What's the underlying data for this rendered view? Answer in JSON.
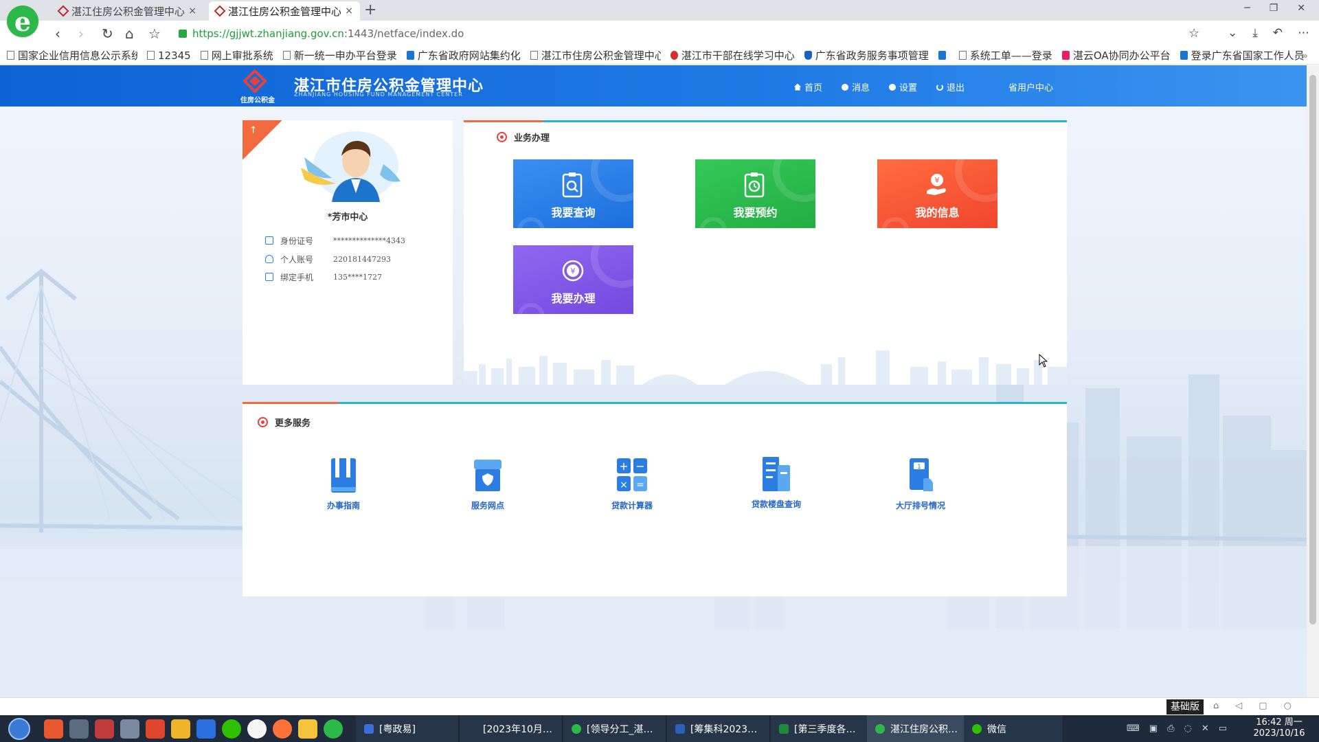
{
  "browser": {
    "logo_letter": "e",
    "tabs": [
      {
        "title": "湛江住房公积金管理中心",
        "active": false
      },
      {
        "title": "湛江住房公积金管理中心",
        "active": true
      }
    ],
    "new_tab": "+",
    "close_glyph": "×",
    "url_secure": "https://gjjwt.zhanjiang.gov.cn",
    "url_rest": ":1443/netface/index.do",
    "bookmarks": [
      {
        "label": "国家企业信用信息公示系统",
        "icon": "page"
      },
      {
        "label": "12345",
        "icon": "page"
      },
      {
        "label": "网上审批系统",
        "icon": "page"
      },
      {
        "label": "新一统一申办平台登录",
        "icon": "page"
      },
      {
        "label": "广东省政府网站集约化",
        "icon": "blue"
      },
      {
        "label": "湛江市住房公积金管理中心",
        "icon": "page"
      },
      {
        "label": "湛江市干部在线学习中心",
        "icon": "red"
      },
      {
        "label": "广东省政务服务事项管理",
        "icon": "shield"
      },
      {
        "label": "",
        "icon": "blue"
      },
      {
        "label": "系统工单——登录",
        "icon": "page"
      },
      {
        "label": "湛云OA协同办公平台",
        "icon": "pink"
      },
      {
        "label": "登录广东省国家工作人员",
        "icon": "blue"
      }
    ],
    "bookmark_more": "»"
  },
  "header": {
    "title": "湛江市住房公积金管理中心",
    "subtitle": "ZHANJIANG HOUSING FUND MANAGEMENT CENTER",
    "logo_sub": "住房公积金",
    "nav": [
      {
        "label": "首页",
        "icon": "home-icon"
      },
      {
        "label": "消息",
        "icon": "message-icon"
      },
      {
        "label": "设置",
        "icon": "gear-icon"
      },
      {
        "label": "退出",
        "icon": "power-icon"
      }
    ],
    "user_center": "省用户中心"
  },
  "profile": {
    "name": "*芳市中心",
    "ribbon": "↗",
    "rows": [
      {
        "label": "身份证号",
        "value": "**************4343",
        "icon": "id-card-icon"
      },
      {
        "label": "个人账号",
        "value": "220181447293",
        "icon": "user-icon"
      },
      {
        "label": "绑定手机",
        "value": "135****1727",
        "icon": "phone-icon"
      }
    ]
  },
  "business": {
    "title": "业务办理",
    "tiles": [
      {
        "label": "我要查询",
        "color": "#2b7de1",
        "icon": "search-doc-icon"
      },
      {
        "label": "我要预约",
        "color": "#2dbb4e",
        "icon": "clock-doc-icon"
      },
      {
        "label": "我的信息",
        "color": "#f5583a",
        "icon": "hand-money-icon"
      },
      {
        "label": "我要办理",
        "color": "#7f57e8",
        "icon": "yuan-coin-icon"
      }
    ]
  },
  "more_services": {
    "title": "更多服务",
    "items": [
      {
        "label": "办事指南",
        "icon": "book-icon"
      },
      {
        "label": "服务网点",
        "icon": "store-icon"
      },
      {
        "label": "贷款计算器",
        "icon": "calculator-icon"
      },
      {
        "label": "贷款楼盘查询",
        "icon": "building-icon"
      },
      {
        "label": "大厅排号情况",
        "icon": "queue-ticket-icon"
      }
    ]
  },
  "status": {
    "basic_version": "基础版"
  },
  "taskbar": {
    "tasks": [
      {
        "label": "[粤政易]",
        "color": "#3a6fd8"
      },
      {
        "label": "[2023年10月…",
        "color": "#263547"
      },
      {
        "label": "[领导分工_湛…",
        "color": "#2db84a"
      },
      {
        "label": "[筹集科2023…",
        "color": "#2b5fb8"
      },
      {
        "label": "[第三季度各…",
        "color": "#1f8a3c"
      },
      {
        "label": "湛江住房公积…",
        "color": "#2db84a",
        "active": true
      },
      {
        "label": "微信",
        "color": "#2dc100"
      }
    ],
    "time": "16:42 周一",
    "date": "2023/10/16"
  }
}
